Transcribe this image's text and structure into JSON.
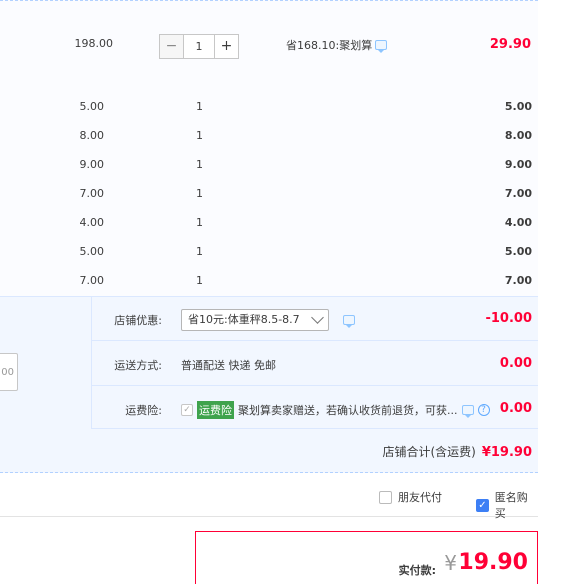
{
  "main_item": {
    "price": "198.00",
    "qty": "1",
    "minus": "−",
    "plus": "+",
    "promo_text": "省168.10:聚划算",
    "total": "29.90"
  },
  "sub_items": [
    {
      "price": "5.00",
      "qty": "1",
      "total": "5.00"
    },
    {
      "price": "8.00",
      "qty": "1",
      "total": "8.00"
    },
    {
      "price": "9.00",
      "qty": "1",
      "total": "9.00"
    },
    {
      "price": "7.00",
      "qty": "1",
      "total": "7.00"
    },
    {
      "price": "4.00",
      "qty": "1",
      "total": "4.00"
    },
    {
      "price": "5.00",
      "qty": "1",
      "total": "5.00"
    },
    {
      "price": "7.00",
      "qty": "1",
      "total": "7.00"
    }
  ],
  "left_input_value": "00",
  "shop": {
    "coupon_label": "店铺优惠:",
    "coupon_value": "省10元:体重秤8.5-8.7",
    "coupon_amount": "-10.00",
    "shipping_label": "运送方式:",
    "shipping_value": "普通配送 快递 免邮",
    "shipping_amount": "0.00",
    "insurance_label": "运费险:",
    "insurance_tag": "运费险",
    "insurance_text": "聚划算卖家赠送，若确认收货前退货，可获...",
    "insurance_amount": "0.00",
    "subtotal_label": "店铺合计(含运费)",
    "subtotal_amount": "¥19.90"
  },
  "options": {
    "friend_pay": "朋友代付",
    "anonymous": "匿名购买"
  },
  "payment": {
    "label": "实付款:",
    "currency": "¥",
    "amount": "19.90"
  },
  "colors": {
    "accent_red": "#ff0036",
    "border_blue": "#b2d1ff",
    "panel_blue": "#f2f7ff",
    "check_blue": "#3d7ff5",
    "insurance_green": "#3fa34d"
  }
}
